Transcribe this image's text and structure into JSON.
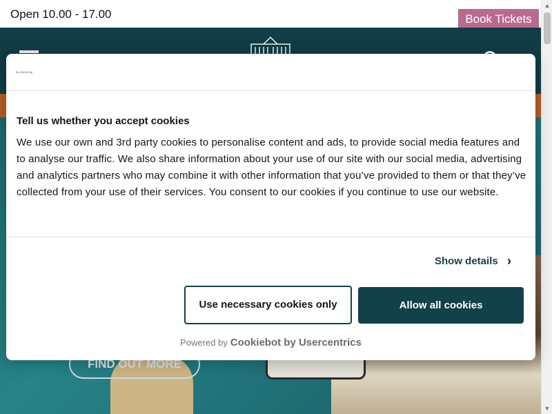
{
  "topbar": {
    "opening_hours": "Open 10.00 - 17.00",
    "book_tickets": "Book Tickets"
  },
  "header": {
    "menu_icon": "hamburger-menu-icon",
    "logo_icon": "palace-logo-icon",
    "search_icon": "search-icon"
  },
  "hero": {
    "cta": "FIND OUT MORE"
  },
  "cookie_dialog": {
    "logo_text": "BLENHEIM",
    "title": "Tell us whether you accept cookies",
    "body": "We use our own and 3rd party cookies to personalise content and ads, to provide social media features and to analyse our traffic. We also share information about your use of our site with our social media, advertising and analytics partners who may combine it with other information that you’ve provided to them or that they’ve collected from your use of their services. You consent to our cookies if you continue to use our website.",
    "show_details": "Show details",
    "chevron": "›",
    "necessary_button": "Use necessary cookies only",
    "allow_button": "Allow all cookies",
    "powered_by": "Powered by",
    "powered_brand": "Cookiebot by Usercentrics"
  },
  "colors": {
    "header_bg": "#12414a",
    "book_button_bg": "#b96b8f",
    "orange_band": "#c0642a",
    "allow_button_bg": "#12414a"
  },
  "scrollbar": {
    "up_arrow": "▲",
    "down_arrow": "▼"
  }
}
